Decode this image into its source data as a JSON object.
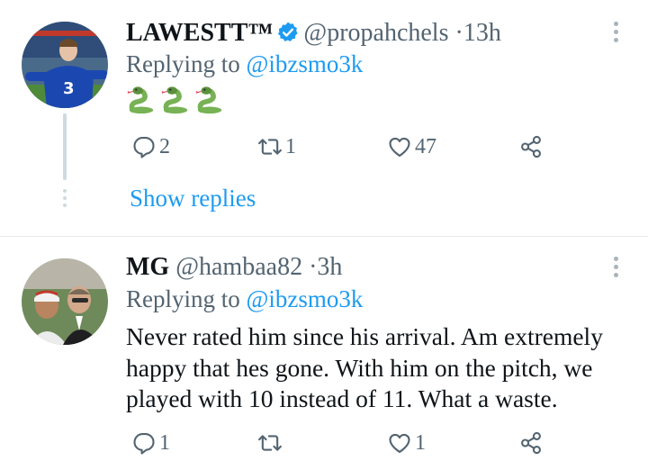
{
  "tweets": [
    {
      "name": "LAWESTT™",
      "handle": "@propahchels",
      "separator": "·",
      "time": "13h",
      "replying_prefix": "Replying to",
      "replying_to": "@ibzsmo3k",
      "emojis": [
        "snake",
        "snake",
        "snake"
      ],
      "reply_count": "2",
      "retweet_count": "1",
      "like_count": "47",
      "show_replies": "Show replies",
      "verified": true
    },
    {
      "name": "MG",
      "handle": "@hambaa82",
      "separator": "·",
      "time": "3h",
      "replying_prefix": "Replying to",
      "replying_to": "@ibzsmo3k",
      "text": "Never rated him since his arrival. Am extremely happy that hes gone. With him on the pitch, we played with 10 instead of 11. What a waste.",
      "reply_count": "1",
      "retweet_count": "",
      "like_count": "1",
      "verified": false
    }
  ],
  "colors": {
    "link": "#1d9bf0",
    "secondary": "#536471",
    "thread_line": "#cfd9de",
    "verified": "#1d9bf0"
  }
}
